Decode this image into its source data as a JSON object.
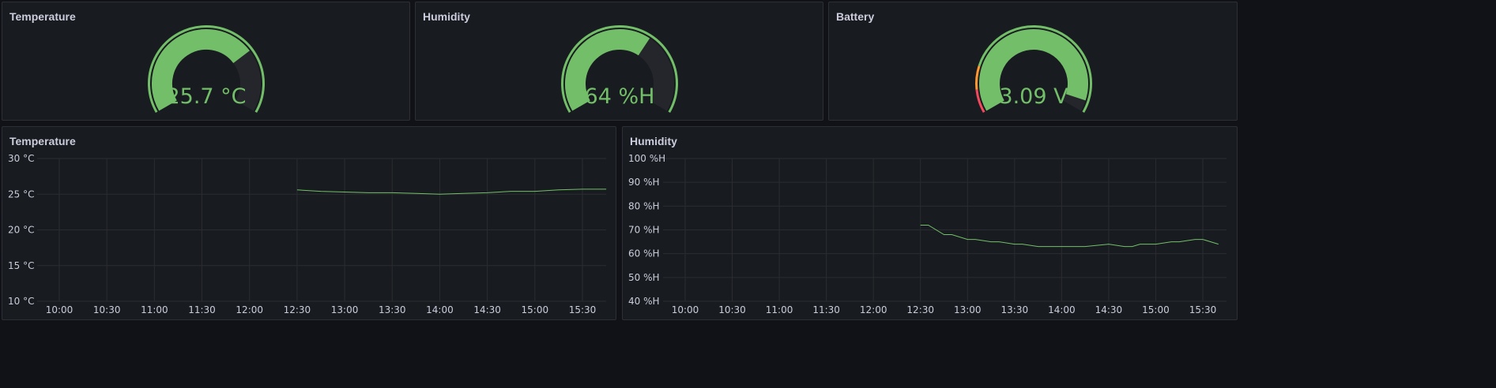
{
  "colors": {
    "background": "#111217",
    "panel": "#181b1f",
    "panel_border": "#2c2f36",
    "green": "#73bf69",
    "gauge_track": "#24262b",
    "grid": "#2a2c31",
    "threshold_red": "#f2495c",
    "threshold_orange": "#ff9830",
    "text": "#ccccdc"
  },
  "gauges": [
    {
      "title": "Temperature",
      "value_text": "25.7 °C",
      "fill_fraction": 0.72,
      "threshold_band": "green"
    },
    {
      "title": "Humidity",
      "value_text": "64 %H",
      "fill_fraction": 0.64,
      "threshold_band": "green"
    },
    {
      "title": "Battery",
      "value_text": "3.09 V",
      "fill_fraction": 0.95,
      "threshold_band": "red-orange-green"
    }
  ],
  "chart_data": [
    {
      "type": "line",
      "title": "Temperature",
      "x_ticks": [
        "10:00",
        "10:30",
        "11:00",
        "11:30",
        "12:00",
        "12:30",
        "13:00",
        "13:30",
        "14:00",
        "14:30",
        "15:00",
        "15:30"
      ],
      "y_ticks": [
        "30 °C",
        "25 °C",
        "20 °C",
        "15 °C",
        "10 °C"
      ],
      "ylim": [
        10,
        30
      ],
      "grid": true,
      "series": [
        {
          "color": "#73bf69",
          "x": [
            "12:30",
            "12:45",
            "13:00",
            "13:15",
            "13:30",
            "13:45",
            "14:00",
            "14:15",
            "14:30",
            "14:45",
            "15:00",
            "15:15",
            "15:30",
            "15:45"
          ],
          "y": [
            25.6,
            25.4,
            25.3,
            25.2,
            25.2,
            25.1,
            25.0,
            25.1,
            25.2,
            25.4,
            25.4,
            25.6,
            25.7,
            25.7
          ]
        }
      ]
    },
    {
      "type": "line",
      "title": "Humidity",
      "x_ticks": [
        "10:00",
        "10:30",
        "11:00",
        "11:30",
        "12:00",
        "12:30",
        "13:00",
        "13:30",
        "14:00",
        "14:30",
        "15:00",
        "15:30"
      ],
      "y_ticks": [
        "100 %H",
        "90 %H",
        "80 %H",
        "70 %H",
        "60 %H",
        "50 %H",
        "40 %H"
      ],
      "ylim": [
        40,
        100
      ],
      "grid": true,
      "series": [
        {
          "color": "#73bf69",
          "x": [
            "12:30",
            "12:35",
            "12:45",
            "12:50",
            "13:00",
            "13:05",
            "13:15",
            "13:20",
            "13:30",
            "13:35",
            "13:45",
            "14:00",
            "14:15",
            "14:30",
            "14:40",
            "14:45",
            "14:50",
            "15:00",
            "15:10",
            "15:15",
            "15:25",
            "15:30",
            "15:40"
          ],
          "y": [
            72,
            72,
            68,
            68,
            66,
            66,
            65,
            65,
            64,
            64,
            63,
            63,
            63,
            64,
            63,
            63,
            64,
            64,
            65,
            65,
            66,
            66,
            64
          ]
        }
      ]
    }
  ]
}
